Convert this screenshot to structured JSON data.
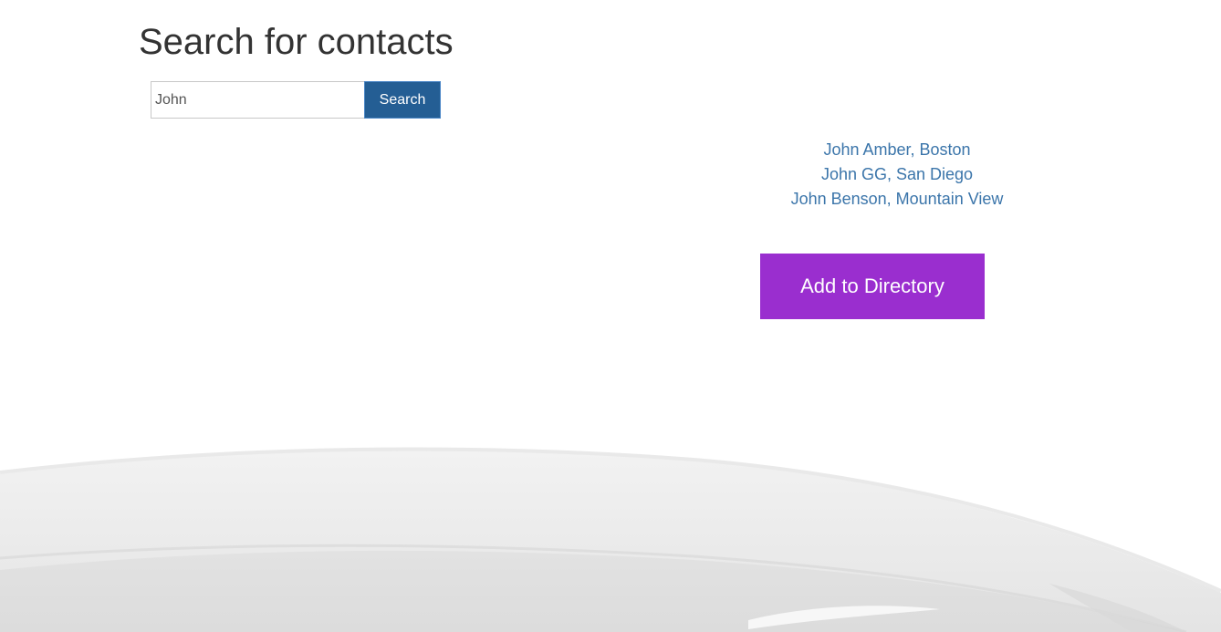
{
  "page": {
    "title": "Search for contacts"
  },
  "search": {
    "value": "John",
    "button_label": "Search"
  },
  "results": [
    "John Amber, Boston",
    "John GG, San Diego",
    "John Benson, Mountain View"
  ],
  "actions": {
    "add_label": "Add to Directory"
  },
  "colors": {
    "primary_button": "#245e94",
    "accent_button": "#9a2ecf",
    "link": "#3b75aa",
    "title_text": "#333333"
  }
}
